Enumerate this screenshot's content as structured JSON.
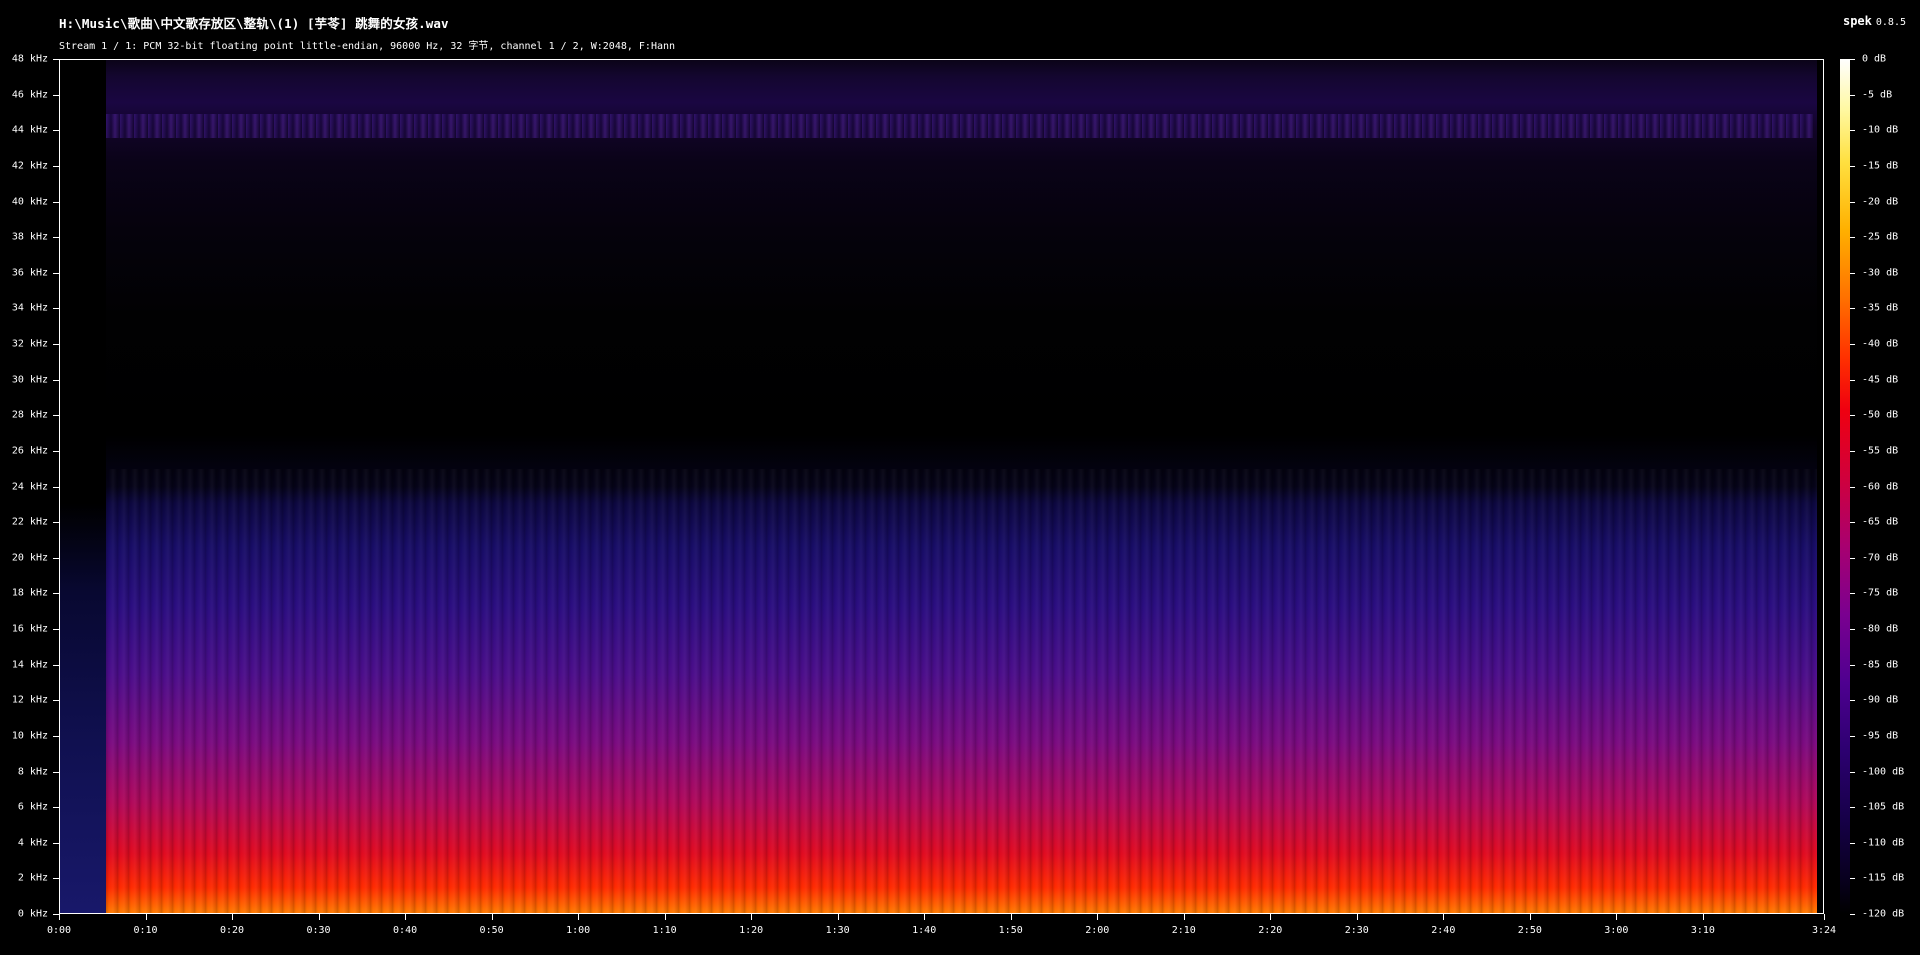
{
  "header": {
    "title": "H:\\Music\\歌曲\\中文歌存放区\\整轨\\(1) [芋苓] 跳舞的女孩.wav",
    "subtitle": "Stream 1 / 1: PCM 32-bit floating point little-endian, 96000 Hz, 32 字节, channel 1 / 2, W:2048, F:Hann",
    "app_name": "spek",
    "app_version": "0.8.5"
  },
  "chart_data": {
    "type": "heatmap",
    "title": "",
    "xlabel": "",
    "ylabel": "",
    "x_axis": {
      "range_seconds": [
        0,
        204
      ],
      "tick_labels": [
        "0:00",
        "0:10",
        "0:20",
        "0:30",
        "0:40",
        "0:50",
        "1:00",
        "1:10",
        "1:20",
        "1:30",
        "1:40",
        "1:50",
        "2:00",
        "2:10",
        "2:20",
        "2:30",
        "2:40",
        "2:50",
        "3:00",
        "3:10",
        "3:24"
      ],
      "tick_seconds": [
        0,
        10,
        20,
        30,
        40,
        50,
        60,
        70,
        80,
        90,
        100,
        110,
        120,
        130,
        140,
        150,
        160,
        170,
        180,
        190,
        204
      ]
    },
    "y_axis": {
      "unit": "kHz",
      "range": [
        0,
        48
      ],
      "tick_labels": [
        "0 kHz",
        "2 kHz",
        "4 kHz",
        "6 kHz",
        "8 kHz",
        "10 kHz",
        "12 kHz",
        "14 kHz",
        "16 kHz",
        "18 kHz",
        "20 kHz",
        "22 kHz",
        "24 kHz",
        "26 kHz",
        "28 kHz",
        "30 kHz",
        "32 kHz",
        "34 kHz",
        "36 kHz",
        "38 kHz",
        "40 kHz",
        "42 kHz",
        "44 kHz",
        "46 kHz",
        "48 kHz"
      ],
      "tick_values": [
        0,
        2,
        4,
        6,
        8,
        10,
        12,
        14,
        16,
        18,
        20,
        22,
        24,
        26,
        28,
        30,
        32,
        34,
        36,
        38,
        40,
        42,
        44,
        46,
        48
      ]
    },
    "color_scale": {
      "unit": "dB",
      "range": [
        -120,
        0
      ],
      "tick_labels": [
        "0 dB",
        "-5 dB",
        "-10 dB",
        "-15 dB",
        "-20 dB",
        "-25 dB",
        "-30 dB",
        "-35 dB",
        "-40 dB",
        "-45 dB",
        "-50 dB",
        "-55 dB",
        "-60 dB",
        "-65 dB",
        "-70 dB",
        "-75 dB",
        "-80 dB",
        "-85 dB",
        "-90 dB",
        "-95 dB",
        "-100 dB",
        "-105 dB",
        "-110 dB",
        "-115 dB",
        "-120 dB"
      ],
      "tick_values": [
        0,
        -5,
        -10,
        -15,
        -20,
        -25,
        -30,
        -35,
        -40,
        -45,
        -50,
        -55,
        -60,
        -65,
        -70,
        -75,
        -80,
        -85,
        -90,
        -95,
        -100,
        -105,
        -110,
        -115,
        -120
      ]
    }
  }
}
